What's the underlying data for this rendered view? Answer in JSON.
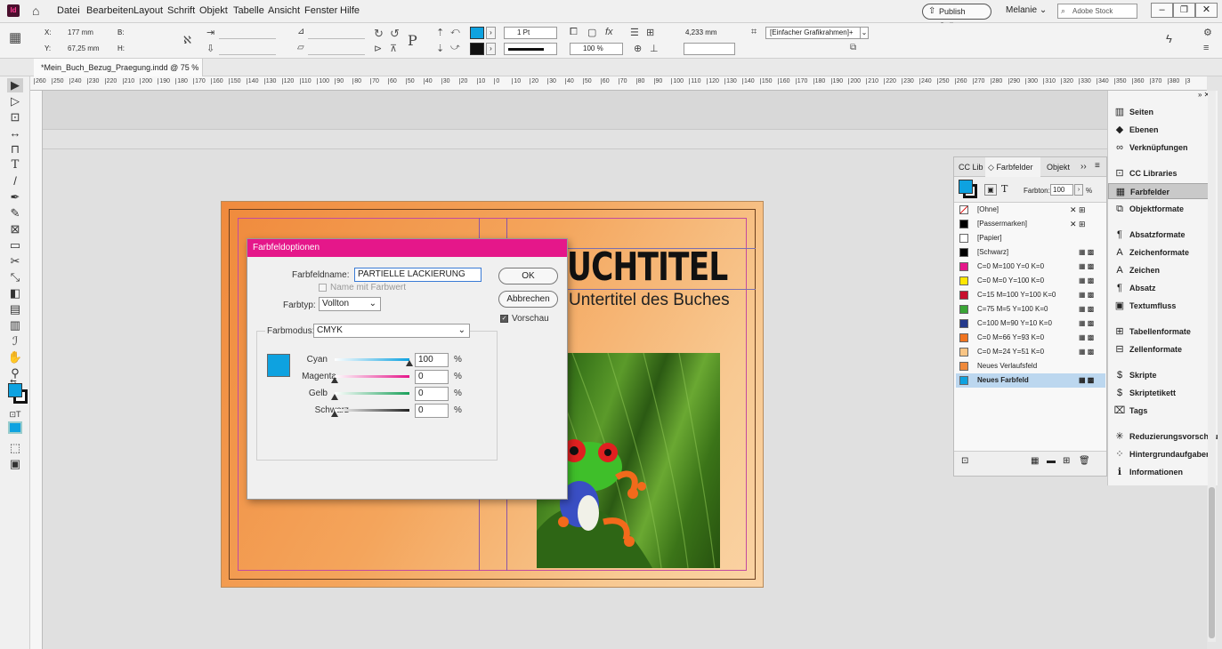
{
  "menubar": {
    "items": [
      "Datei",
      "Bearbeiten",
      "Layout",
      "Schrift",
      "Objekt",
      "Tabelle",
      "Ansicht",
      "Fenster",
      "Hilfe"
    ],
    "publish_label": "Publish Online",
    "user_label": "Melanie",
    "search_placeholder": "Adobe Stock"
  },
  "controlbar": {
    "x_label": "X:",
    "x_value": "177 mm",
    "y_label": "Y:",
    "y_value": "67,25 mm",
    "b_label": "B:",
    "h_label": "H:",
    "stroke_weight": "1 Pt",
    "opacity": "100 %",
    "size_value": "4,233 mm",
    "frame_style": "[Einfacher Grafikrahmen]+"
  },
  "document_tab": {
    "label": "*Mein_Buch_Bezug_Praegung.indd @ 75 %",
    "close": "×"
  },
  "ruler": {
    "h_ticks": [
      "260",
      "250",
      "240",
      "230",
      "220",
      "210",
      "200",
      "190",
      "180",
      "170",
      "160",
      "150",
      "140",
      "130",
      "120",
      "110",
      "100",
      "90",
      "80",
      "70",
      "60",
      "50",
      "40",
      "30",
      "20",
      "10",
      "0",
      "10",
      "20",
      "30",
      "40",
      "50",
      "60",
      "70",
      "80",
      "90",
      "100",
      "110",
      "120",
      "130",
      "140",
      "150",
      "160",
      "170",
      "180",
      "190",
      "200",
      "210",
      "220",
      "230",
      "240",
      "250",
      "260",
      "270",
      "280",
      "290",
      "300",
      "310",
      "320",
      "330",
      "340",
      "350",
      "360",
      "370",
      "380",
      "3"
    ]
  },
  "canvas": {
    "title_text": "UCHTITEL",
    "subtitle_text": "Untertitel des Buches"
  },
  "dialog": {
    "title": "Farbfeldoptionen",
    "name_label": "Farbfeldname:",
    "name_value": "PARTIELLE LACKIERUNG",
    "name_with_value_label": "Name mit Farbwert",
    "type_label": "Farbtyp:",
    "type_value": "Vollton",
    "mode_label": "Farbmodus:",
    "mode_value": "CMYK",
    "ok_label": "OK",
    "cancel_label": "Abbrechen",
    "preview_label": "Vorschau",
    "preview_color": "#0ea2e0",
    "sliders": [
      {
        "label": "Cyan",
        "value": "100",
        "unit": "%",
        "level": 1.0
      },
      {
        "label": "Magenta",
        "value": "0",
        "unit": "%",
        "level": 0
      },
      {
        "label": "Gelb",
        "value": "0",
        "unit": "%",
        "level": 0
      },
      {
        "label": "Schwarz",
        "value": "0",
        "unit": "%",
        "level": 0
      }
    ]
  },
  "swatches_panel": {
    "tabs": [
      "CC Lib",
      "Farbfelder",
      "Objekt"
    ],
    "tint_label": "Farbton:",
    "tint_value": "100",
    "tint_unit": "%",
    "rows": [
      {
        "label": "[Ohne]",
        "color": "#ffffff"
      },
      {
        "label": "[Passermarken]",
        "color": "#000000"
      },
      {
        "label": "[Papier]",
        "color": "#ffffff"
      },
      {
        "label": "[Schwarz]",
        "color": "#000000"
      },
      {
        "label": "C=0 M=100 Y=0 K=0",
        "color": "#e5178a"
      },
      {
        "label": "C=0 M=0 Y=100 K=0",
        "color": "#ffe600"
      },
      {
        "label": "C=15 M=100 Y=100 K=0",
        "color": "#c8102e"
      },
      {
        "label": "C=75 M=5 Y=100 K=0",
        "color": "#3aa535"
      },
      {
        "label": "C=100 M=90 Y=10 K=0",
        "color": "#253a8c"
      },
      {
        "label": "C=0 M=66 Y=93 K=0",
        "color": "#f07420"
      },
      {
        "label": "C=0 M=24 Y=51 K=0",
        "color": "#f9c585"
      },
      {
        "label": "Neues Verlaufsfeld",
        "color": "#f08a3c"
      },
      {
        "label": "Neues Farbfeld",
        "color": "#0ea2e0"
      }
    ]
  },
  "right_panel": {
    "items": [
      {
        "label": "Seiten",
        "icon": "pages-icon"
      },
      {
        "label": "Ebenen",
        "icon": "layers-icon"
      },
      {
        "label": "Verknüpfungen",
        "icon": "links-icon"
      },
      {
        "label": "CC Libraries",
        "icon": "cc-libraries-icon"
      },
      {
        "label": "Farbfelder",
        "icon": "swatches-icon"
      },
      {
        "label": "Objektformate",
        "icon": "object-styles-icon"
      },
      {
        "label": "Absatzformate",
        "icon": "paragraph-styles-icon"
      },
      {
        "label": "Zeichenformate",
        "icon": "character-styles-icon"
      },
      {
        "label": "Zeichen",
        "icon": "character-icon"
      },
      {
        "label": "Absatz",
        "icon": "paragraph-icon"
      },
      {
        "label": "Textumfluss",
        "icon": "text-wrap-icon"
      },
      {
        "label": "Tabellenformate",
        "icon": "table-styles-icon"
      },
      {
        "label": "Zellenformate",
        "icon": "cell-styles-icon"
      },
      {
        "label": "Skripte",
        "icon": "scripts-icon"
      },
      {
        "label": "Skriptetikett",
        "icon": "script-label-icon"
      },
      {
        "label": "Tags",
        "icon": "tags-icon"
      },
      {
        "label": "Reduzierungsvorschau",
        "icon": "flattener-icon"
      },
      {
        "label": "Hintergrundaufgaben",
        "icon": "background-tasks-icon"
      },
      {
        "label": "Informationen",
        "icon": "info-icon"
      }
    ]
  }
}
